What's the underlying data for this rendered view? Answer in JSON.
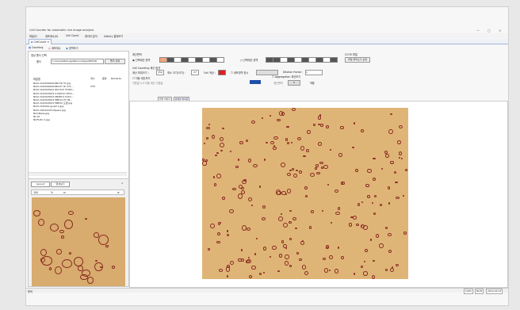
{
  "window": {
    "title": "Cell Counter for automatic rice image analysis",
    "minimize": "—",
    "maximize": "□",
    "close": "×"
  },
  "menus": [
    "파일(F)",
    "세포계수(S)",
    "Cell Count",
    "데이터 분석",
    "Gallery 결과보기"
  ],
  "doc_tab": "CellCount",
  "toolbar": [
    "Counting",
    "세포계수",
    "영역보기"
  ],
  "left": {
    "heading1": "영상 폴더 선택",
    "folder_label": "폴더",
    "folder_path": "C:\\Users\\Malcoge\\NiCountApp\\RESUR",
    "folder_button": "폴더 선택",
    "list_header": "파일명",
    "col_headers": [
      "개수",
      "종류",
      "Remarks"
    ],
    "files": [
      {
        "name": "NiCO-SU20190001B6 FR 37.jpg",
        "count": "",
        "remark": ""
      },
      {
        "name": "NiCO-SU20190001B9-P7 ID 37C...",
        "count": "378",
        "remark": ""
      },
      {
        "name": "NiCO-SU2013002 ID0 P10 3700C...",
        "count": "",
        "remark": ""
      },
      {
        "name": "NiCO-SU2013003 C14(P10 CPCC...",
        "count": "",
        "remark": ""
      },
      {
        "name": "NiCO-SU2013003 0B4P10 CUCC...",
        "count": "",
        "remark": ""
      },
      {
        "name": "NiCO-SU2013003 HBP12 P7 IM...",
        "count": "",
        "remark": ""
      },
      {
        "name": "NiCO-SU2013003 HBP22 도면.jpg",
        "count": "",
        "remark": ""
      },
      {
        "name": "NiCO-SU2019 guest 2.jpg",
        "count": "",
        "remark": ""
      },
      {
        "name": "NiCO-0201910116yee1.jpg",
        "count": "",
        "remark": ""
      },
      {
        "name": "NiCoNasa.jpg",
        "count": "",
        "remark": ""
      },
      {
        "name": "Nu.tif",
        "count": "",
        "remark": ""
      },
      {
        "name": "NUFLOC 2.jpg",
        "count": "",
        "remark": ""
      }
    ],
    "preview_tabs": [
      "Layout",
      "영상보기"
    ],
    "zoom_value": "100",
    "zoom_unit": "%"
  },
  "settings": {
    "region_heading": "계산면적",
    "region_opt1": "선택계산 영역",
    "region_opt2": "선택계산 영역",
    "cct_heading": "CCCR 파일",
    "cct_button": "파일 불러오기 보정",
    "params_heading": "Cell Counting 계산 옵션",
    "min_size_label": "계산 최대크기 :",
    "min_size_value": "350",
    "max_size_label": "최소 크기(크기) :",
    "max_size_value": "27",
    "color_label": "Cell 색상 :",
    "check_view": "세포영역 표시",
    "dilution_label": "Dilution Factor :",
    "dilution_value": "1",
    "check_auto": "자동 계산보기",
    "check_aggregation": "Aggregation 계산보기",
    "auto_detail": "기준값 0.3  자동 계산  기본값",
    "btn_apply": "적용",
    "result_label": "계산면적",
    "result_value": "0"
  },
  "image_tabs": [
    "원본 이미지",
    "분석된 이미지"
  ],
  "status": {
    "left": "준비",
    "caps": "CAPS",
    "num": "NUM",
    "date": "2019-03-07"
  },
  "colors": {
    "selected_swatch": "#f2a679",
    "cell_color_swatch": "#e02020",
    "aggregation_swatch": "#1f4fa8"
  }
}
